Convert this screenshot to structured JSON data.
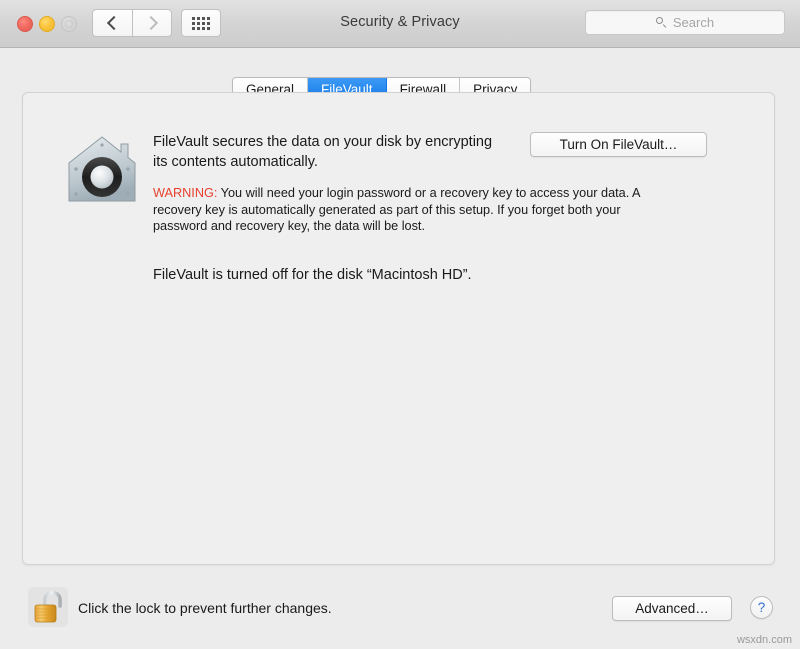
{
  "window": {
    "title": "Security & Privacy",
    "traffic_lights": [
      {
        "name": "close",
        "color": "#f26b61",
        "enabled": true
      },
      {
        "name": "minimize",
        "color": "#fbc33b",
        "enabled": true
      },
      {
        "name": "zoom",
        "color": "#d6d6d6",
        "enabled": false
      }
    ]
  },
  "toolbar": {
    "back_icon": "chevron-left-icon",
    "forward_icon": "chevron-right-icon",
    "grid_icon": "show-all-grid-icon",
    "search": {
      "placeholder": "Search",
      "value": "",
      "icon": "search-icon"
    }
  },
  "tabs": [
    {
      "label": "General",
      "active": false
    },
    {
      "label": "FileVault",
      "active": true
    },
    {
      "label": "Firewall",
      "active": false
    },
    {
      "label": "Privacy",
      "active": false
    }
  ],
  "main": {
    "icon": "filevault-house-icon",
    "intro": "FileVault secures the data on your disk by encrypting its contents automatically.",
    "warning_label": "WARNING:",
    "warning_text": " You will need your login password or a recovery key to access your data. A recovery key is automatically generated as part of this setup. If you forget both your password and recovery key, the data will be lost.",
    "status": "FileVault is turned off for the disk “Macintosh HD”.",
    "turn_on_button": "Turn On FileVault…"
  },
  "footer": {
    "lock_icon": "unlocked-padlock-icon",
    "lock_caption": "Click the lock to prevent further changes.",
    "advanced_button": "Advanced…",
    "help_button": "?"
  },
  "watermark": "wsxdn.com",
  "colors": {
    "accent_blue": "#1478e8",
    "warning_red": "#e8412f",
    "help_blue": "#2f6fd0",
    "panel_bg": "#efefef",
    "window_bg": "#ececec"
  }
}
